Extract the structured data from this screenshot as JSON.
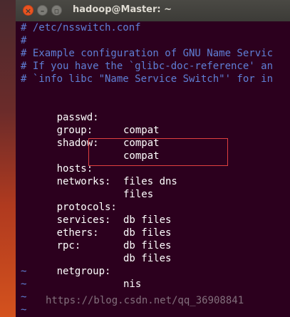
{
  "window": {
    "title": "hadoop@Master: ~",
    "close_glyph": "×",
    "min_glyph": "–",
    "max_glyph": "▫"
  },
  "comments": [
    "# /etc/nsswitch.conf",
    "#",
    "# Example configuration of GNU Name Servic",
    "# If you have the `glibc-doc-reference' an",
    "# `info libc \"Name Service Switch\"' for in"
  ],
  "entries_group1": [
    {
      "key": "passwd:",
      "value": "compat"
    },
    {
      "key": "group:",
      "value": "compat"
    },
    {
      "key": "shadow:",
      "value": "compat"
    }
  ],
  "entries_group2": [
    {
      "key": "hosts:",
      "value": "files dns"
    },
    {
      "key": "networks:",
      "value": "files"
    }
  ],
  "entries_group3": [
    {
      "key": "protocols:",
      "value": "db files"
    },
    {
      "key": "services:",
      "value": "db files"
    },
    {
      "key": "ethers:",
      "value": "db files"
    },
    {
      "key": "rpc:",
      "value": "db files"
    }
  ],
  "entries_group4": [
    {
      "key": "netgroup:",
      "value": "nis"
    }
  ],
  "tilde_lines": [
    "~",
    "~",
    "~",
    "~"
  ],
  "watermark": "https://blog.csdn.net/qq_36908841",
  "colors": {
    "background": "#2c001e",
    "comment": "#5f7fd6",
    "text": "#ffffff",
    "highlight": "#e04040",
    "close_button": "#e95420"
  }
}
